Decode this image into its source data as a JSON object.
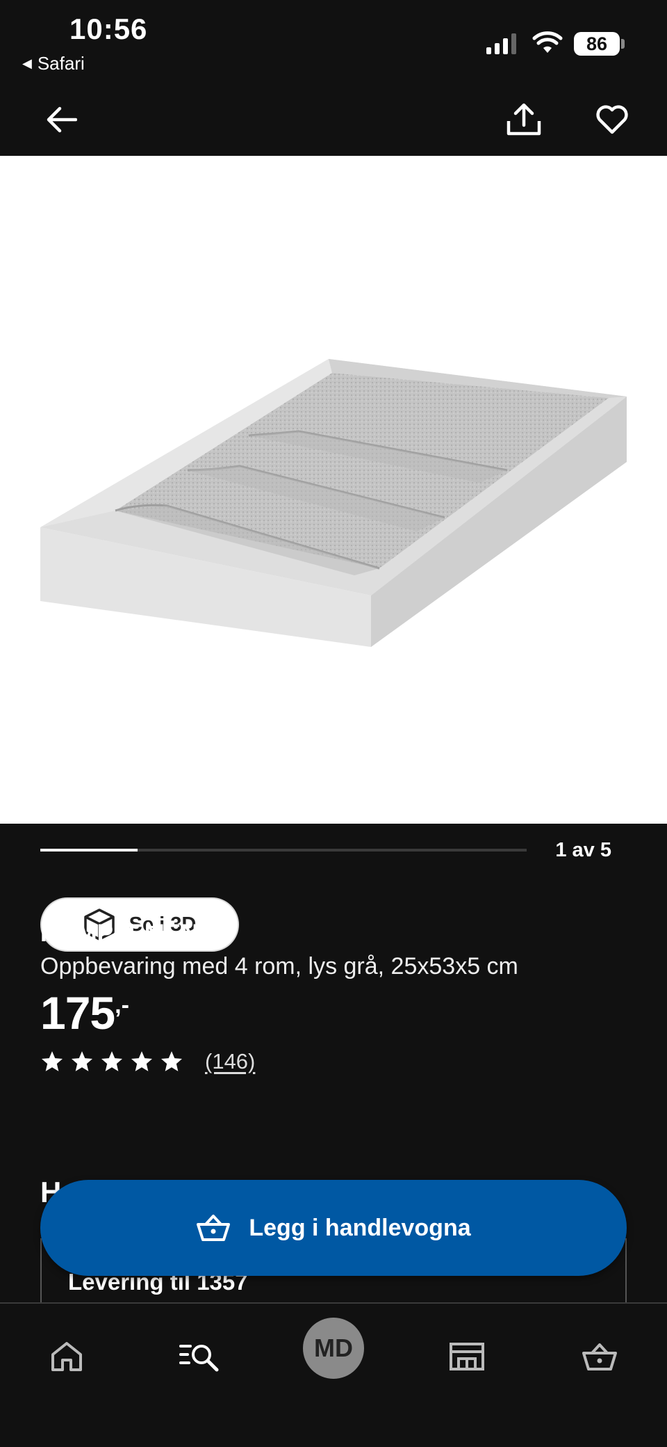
{
  "status_bar": {
    "time": "10:56",
    "back_app": "Safari",
    "battery": "86"
  },
  "nav": {
    "back_icon": "arrow-left-icon",
    "share_icon": "share-icon",
    "favorite_icon": "heart-icon"
  },
  "gallery": {
    "see_3d_label": "Se i 3D",
    "counter": "1 av 5",
    "current": 1,
    "total": 5
  },
  "product": {
    "name": "KOMPLEMENT",
    "description": "Oppbevaring med 4 rom, lys grå, 25x53x5 cm",
    "price": "175",
    "price_suffix": ",-",
    "rating_stars": 5,
    "review_count": "(146)"
  },
  "section_peek": {
    "heading": "H"
  },
  "delivery": {
    "label": "Levering til 1357"
  },
  "cart_button": {
    "label": "Legg i handlevogna",
    "color": "#0058a3"
  },
  "tab_bar": {
    "items": [
      "home-icon",
      "search-icon",
      "profile-avatar",
      "store-icon",
      "cart-icon"
    ],
    "avatar_initials": "MD"
  }
}
